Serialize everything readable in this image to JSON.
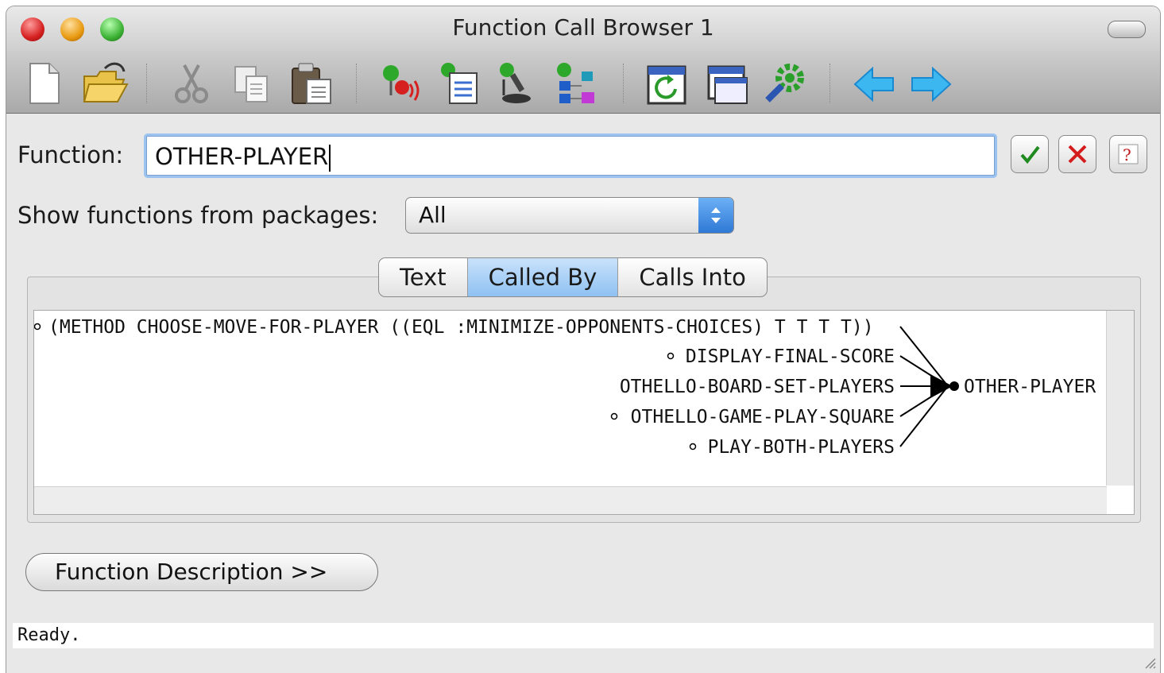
{
  "window": {
    "title": "Function Call Browser 1"
  },
  "toolbar": {
    "icons": [
      "new-document-icon",
      "open-folder-icon",
      "cut-icon",
      "copy-icon",
      "paste-icon",
      "call-in-icon",
      "call-out-icon",
      "inspect-icon",
      "tree-icon",
      "refresh-icon",
      "new-window-icon",
      "preferences-gear-icon",
      "back-arrow-icon",
      "forward-arrow-icon"
    ]
  },
  "form": {
    "function_label": "Function:",
    "function_value": "OTHER-PLAYER",
    "packages_label": "Show functions from packages:",
    "packages_selected": "All"
  },
  "tabs": [
    "Text",
    "Called By",
    "Calls Into"
  ],
  "active_tab": "Called By",
  "graph": {
    "target": "OTHER-PLAYER",
    "callers": [
      "(METHOD CHOOSE-MOVE-FOR-PLAYER ((EQL :MINIMIZE-OPPONENTS-CHOICES) T T T T))",
      "DISPLAY-FINAL-SCORE",
      "OTHELLO-BOARD-SET-PLAYERS",
      "OTHELLO-GAME-PLAY-SQUARE",
      "PLAY-BOTH-PLAYERS"
    ]
  },
  "buttons": {
    "description": "Function Description >>"
  },
  "status": {
    "text": "Ready."
  }
}
